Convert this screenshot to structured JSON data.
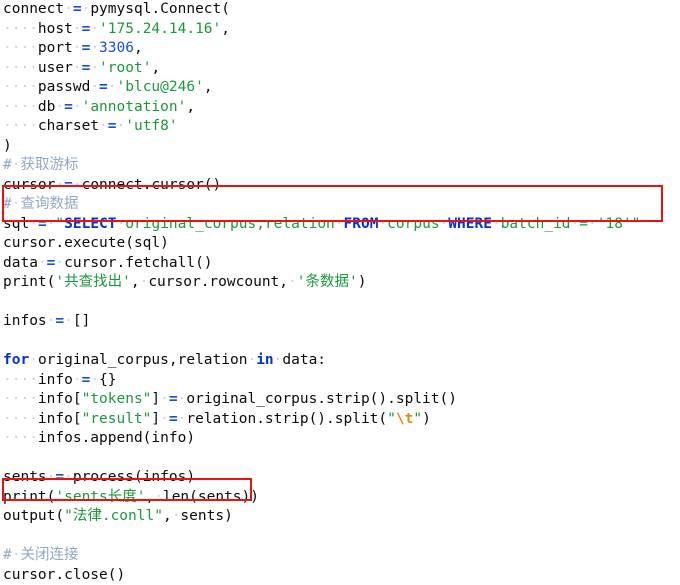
{
  "editor": {
    "language": "python",
    "background_color": "#ffffff",
    "default_text_color": "#0b0b0b"
  },
  "colors": {
    "keyword": "#0033dd",
    "string": "#1a9a3c",
    "number": "#1750e0",
    "operator": "#1750e0",
    "comment": "#93a8c6",
    "escape": "#d98c1a",
    "whitespace_dot": "#c9d0da",
    "annotation_red": "#ee1111"
  },
  "annotations": [
    {
      "name": "sql-query-highlight",
      "shape": "rectangle",
      "color": "#ee1111",
      "covers_lines": [
        "# 查询数据",
        "sql = \"SELECT original_corpus,relation FROM corpus WHERE batch_id = '18'\""
      ]
    },
    {
      "name": "output-call-highlight",
      "shape": "rectangle",
      "color": "#ee1111",
      "covers_lines": [
        "output(\"法律.conll\", sents)"
      ]
    }
  ],
  "code": {
    "lines": [
      {
        "n": 1,
        "text": "connect = pymysql.Connect("
      },
      {
        "n": 2,
        "text": "    host = '175.24.14.16',"
      },
      {
        "n": 3,
        "text": "    port = 3306,"
      },
      {
        "n": 4,
        "text": "    user = 'root',"
      },
      {
        "n": 5,
        "text": "    passwd = 'blcu@246',"
      },
      {
        "n": 6,
        "text": "    db = 'annotation',"
      },
      {
        "n": 7,
        "text": "    charset = 'utf8'"
      },
      {
        "n": 8,
        "text": ")"
      },
      {
        "n": 9,
        "text": "# 获取游标"
      },
      {
        "n": 10,
        "text": "cursor = connect.cursor()"
      },
      {
        "n": 11,
        "text": "# 查询数据"
      },
      {
        "n": 12,
        "text": "sql = \"SELECT original_corpus,relation FROM corpus WHERE batch_id = '18'\""
      },
      {
        "n": 13,
        "text": "cursor.execute(sql)"
      },
      {
        "n": 14,
        "text": "data = cursor.fetchall()"
      },
      {
        "n": 15,
        "text": "print('共查找出', cursor.rowcount, '条数据')"
      },
      {
        "n": 16,
        "text": ""
      },
      {
        "n": 17,
        "text": "infos = []"
      },
      {
        "n": 18,
        "text": ""
      },
      {
        "n": 19,
        "text": "for original_corpus,relation in data:"
      },
      {
        "n": 20,
        "text": "    info = {}"
      },
      {
        "n": 21,
        "text": "    info[\"tokens\"] = original_corpus.strip().split()"
      },
      {
        "n": 22,
        "text": "    info[\"result\"] = relation.strip().split(\"\\t\")"
      },
      {
        "n": 23,
        "text": "    infos.append(info)"
      },
      {
        "n": 24,
        "text": ""
      },
      {
        "n": 25,
        "text": "sents = process(infos)"
      },
      {
        "n": 26,
        "text": "print('sents长度', len(sents))"
      },
      {
        "n": 27,
        "text": "output(\"法律.conll\", sents)"
      },
      {
        "n": 28,
        "text": ""
      },
      {
        "n": 29,
        "text": "# 关闭连接"
      },
      {
        "n": 30,
        "text": "cursor.close()"
      }
    ],
    "tokens": {
      "l1": [
        {
          "t": "connect",
          "c": "plain"
        },
        {
          "t": " ",
          "c": "ws"
        },
        {
          "t": "=",
          "c": "operator"
        },
        {
          "t": " ",
          "c": "ws"
        },
        {
          "t": "pymysql.Connect(",
          "c": "plain"
        }
      ],
      "l2": [
        {
          "t": "    ",
          "c": "ws"
        },
        {
          "t": "host",
          "c": "plain"
        },
        {
          "t": " ",
          "c": "ws"
        },
        {
          "t": "=",
          "c": "operator"
        },
        {
          "t": " ",
          "c": "ws"
        },
        {
          "t": "'175.24.14.16'",
          "c": "string"
        },
        {
          "t": ",",
          "c": "plain"
        }
      ],
      "l3": [
        {
          "t": "    ",
          "c": "ws"
        },
        {
          "t": "port",
          "c": "plain"
        },
        {
          "t": " ",
          "c": "ws"
        },
        {
          "t": "=",
          "c": "operator"
        },
        {
          "t": " ",
          "c": "ws"
        },
        {
          "t": "3306",
          "c": "number"
        },
        {
          "t": ",",
          "c": "plain"
        }
      ],
      "l4": [
        {
          "t": "    ",
          "c": "ws"
        },
        {
          "t": "user",
          "c": "plain"
        },
        {
          "t": " ",
          "c": "ws"
        },
        {
          "t": "=",
          "c": "operator"
        },
        {
          "t": " ",
          "c": "ws"
        },
        {
          "t": "'root'",
          "c": "string"
        },
        {
          "t": ",",
          "c": "plain"
        }
      ],
      "l5": [
        {
          "t": "    ",
          "c": "ws"
        },
        {
          "t": "passwd",
          "c": "plain"
        },
        {
          "t": " ",
          "c": "ws"
        },
        {
          "t": "=",
          "c": "operator"
        },
        {
          "t": " ",
          "c": "ws"
        },
        {
          "t": "'blcu@246'",
          "c": "string"
        },
        {
          "t": ",",
          "c": "plain"
        }
      ],
      "l6": [
        {
          "t": "    ",
          "c": "ws"
        },
        {
          "t": "db",
          "c": "plain"
        },
        {
          "t": " ",
          "c": "ws"
        },
        {
          "t": "=",
          "c": "operator"
        },
        {
          "t": " ",
          "c": "ws"
        },
        {
          "t": "'annotation'",
          "c": "string"
        },
        {
          "t": ",",
          "c": "plain"
        }
      ],
      "l7": [
        {
          "t": "    ",
          "c": "ws"
        },
        {
          "t": "charset",
          "c": "plain"
        },
        {
          "t": " ",
          "c": "ws"
        },
        {
          "t": "=",
          "c": "operator"
        },
        {
          "t": " ",
          "c": "ws"
        },
        {
          "t": "'utf8'",
          "c": "string"
        }
      ],
      "l8": [
        {
          "t": ")",
          "c": "plain"
        }
      ],
      "l9": [
        {
          "t": "#",
          "c": "comment"
        },
        {
          "t": " ",
          "c": "ws"
        },
        {
          "t": "获取游标",
          "c": "comment"
        }
      ],
      "l10": [
        {
          "t": "cursor",
          "c": "plain"
        },
        {
          "t": " ",
          "c": "ws"
        },
        {
          "t": "=",
          "c": "operator"
        },
        {
          "t": " ",
          "c": "ws"
        },
        {
          "t": "connect.cursor()",
          "c": "plain"
        }
      ],
      "l11": [
        {
          "t": "#",
          "c": "comment"
        },
        {
          "t": " ",
          "c": "ws"
        },
        {
          "t": "查询数据",
          "c": "comment"
        }
      ],
      "l12": [
        {
          "t": "sql",
          "c": "plain"
        },
        {
          "t": " ",
          "c": "ws"
        },
        {
          "t": "=",
          "c": "operator"
        },
        {
          "t": " ",
          "c": "ws"
        },
        {
          "t": "\"",
          "c": "string"
        },
        {
          "t": "SELECT",
          "c": "sqlkw"
        },
        {
          "t": " ",
          "c": "ws"
        },
        {
          "t": "original_corpus,relation",
          "c": "string"
        },
        {
          "t": " ",
          "c": "ws"
        },
        {
          "t": "FROM",
          "c": "sqlkw"
        },
        {
          "t": " ",
          "c": "ws"
        },
        {
          "t": "corpus",
          "c": "string"
        },
        {
          "t": " ",
          "c": "ws"
        },
        {
          "t": "WHERE",
          "c": "sqlkw"
        },
        {
          "t": " ",
          "c": "ws"
        },
        {
          "t": "batch_id",
          "c": "string"
        },
        {
          "t": " ",
          "c": "ws"
        },
        {
          "t": "=",
          "c": "string"
        },
        {
          "t": " ",
          "c": "ws"
        },
        {
          "t": "'18'\"",
          "c": "string"
        }
      ],
      "l13": [
        {
          "t": "cursor.execute(sql)",
          "c": "plain"
        }
      ],
      "l14": [
        {
          "t": "data",
          "c": "plain"
        },
        {
          "t": " ",
          "c": "ws"
        },
        {
          "t": "=",
          "c": "operator"
        },
        {
          "t": " ",
          "c": "ws"
        },
        {
          "t": "cursor.fetchall()",
          "c": "plain"
        }
      ],
      "l15": [
        {
          "t": "print(",
          "c": "plain"
        },
        {
          "t": "'共查找出'",
          "c": "string"
        },
        {
          "t": ",",
          "c": "plain"
        },
        {
          "t": " ",
          "c": "ws"
        },
        {
          "t": "cursor.rowcount,",
          "c": "plain"
        },
        {
          "t": " ",
          "c": "ws"
        },
        {
          "t": "'条数据'",
          "c": "string"
        },
        {
          "t": ")",
          "c": "plain"
        }
      ],
      "l16": [],
      "l17": [
        {
          "t": "infos",
          "c": "plain"
        },
        {
          "t": " ",
          "c": "ws"
        },
        {
          "t": "=",
          "c": "operator"
        },
        {
          "t": " ",
          "c": "ws"
        },
        {
          "t": "[]",
          "c": "plain"
        }
      ],
      "l18": [],
      "l19": [
        {
          "t": "for",
          "c": "keyword"
        },
        {
          "t": " ",
          "c": "ws"
        },
        {
          "t": "original_corpus,relation",
          "c": "plain"
        },
        {
          "t": " ",
          "c": "ws"
        },
        {
          "t": "in",
          "c": "keyword"
        },
        {
          "t": " ",
          "c": "ws"
        },
        {
          "t": "data:",
          "c": "plain"
        }
      ],
      "l20": [
        {
          "t": "    ",
          "c": "ws"
        },
        {
          "t": "info",
          "c": "plain"
        },
        {
          "t": " ",
          "c": "ws"
        },
        {
          "t": "=",
          "c": "operator"
        },
        {
          "t": " ",
          "c": "ws"
        },
        {
          "t": "{}",
          "c": "plain"
        }
      ],
      "l21": [
        {
          "t": "    ",
          "c": "ws"
        },
        {
          "t": "info[",
          "c": "plain"
        },
        {
          "t": "\"tokens\"",
          "c": "string"
        },
        {
          "t": "]",
          "c": "plain"
        },
        {
          "t": " ",
          "c": "ws"
        },
        {
          "t": "=",
          "c": "operator"
        },
        {
          "t": " ",
          "c": "ws"
        },
        {
          "t": "original_corpus.strip().split()",
          "c": "plain"
        }
      ],
      "l22": [
        {
          "t": "    ",
          "c": "ws"
        },
        {
          "t": "info[",
          "c": "plain"
        },
        {
          "t": "\"result\"",
          "c": "string"
        },
        {
          "t": "]",
          "c": "plain"
        },
        {
          "t": " ",
          "c": "ws"
        },
        {
          "t": "=",
          "c": "operator"
        },
        {
          "t": " ",
          "c": "ws"
        },
        {
          "t": "relation.strip().split(",
          "c": "plain"
        },
        {
          "t": "\"",
          "c": "string"
        },
        {
          "t": "\\t",
          "c": "escape"
        },
        {
          "t": "\"",
          "c": "string"
        },
        {
          "t": ")",
          "c": "plain"
        }
      ],
      "l23": [
        {
          "t": "    ",
          "c": "ws"
        },
        {
          "t": "infos.append(info)",
          "c": "plain"
        }
      ],
      "l24": [],
      "l25": [
        {
          "t": "sents",
          "c": "plain"
        },
        {
          "t": " ",
          "c": "ws"
        },
        {
          "t": "=",
          "c": "operator"
        },
        {
          "t": " ",
          "c": "ws"
        },
        {
          "t": "process(infos)",
          "c": "plain"
        }
      ],
      "l26": [
        {
          "t": "print(",
          "c": "plain"
        },
        {
          "t": "'sents长度'",
          "c": "string"
        },
        {
          "t": ",",
          "c": "plain"
        },
        {
          "t": " ",
          "c": "ws"
        },
        {
          "t": "len(sents))",
          "c": "plain"
        }
      ],
      "l27": [
        {
          "t": "output(",
          "c": "plain"
        },
        {
          "t": "\"法律.conll\"",
          "c": "string"
        },
        {
          "t": ",",
          "c": "plain"
        },
        {
          "t": " ",
          "c": "ws"
        },
        {
          "t": "sents)",
          "c": "plain"
        }
      ],
      "l28": [],
      "l29": [
        {
          "t": "#",
          "c": "comment"
        },
        {
          "t": " ",
          "c": "ws"
        },
        {
          "t": "关闭连接",
          "c": "comment"
        }
      ],
      "l30": [
        {
          "t": "cursor.close()",
          "c": "plain"
        }
      ]
    }
  }
}
